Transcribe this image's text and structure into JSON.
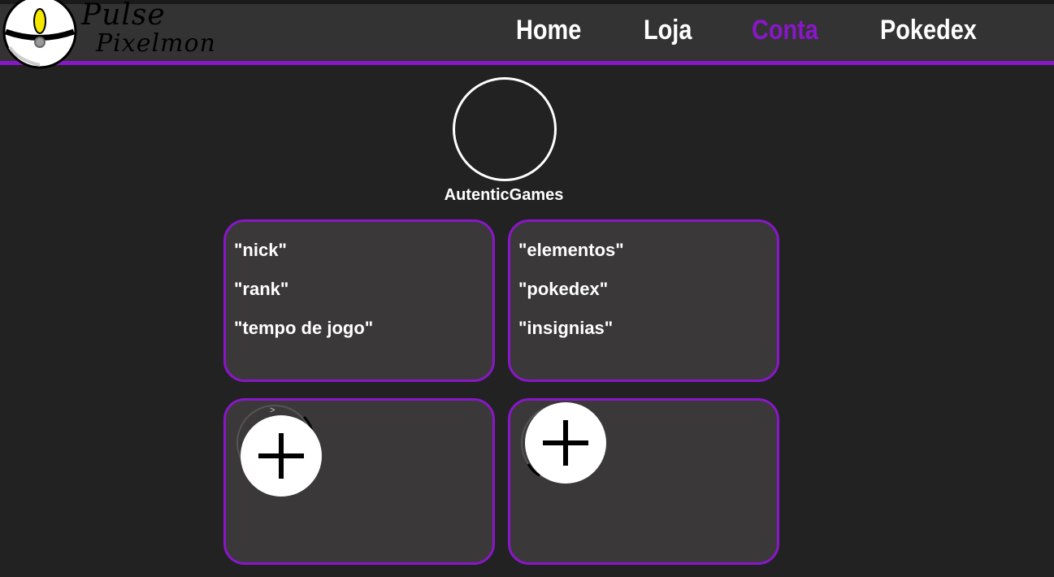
{
  "brand": {
    "line1": "Pulse",
    "line2": "Pixelmon",
    "logo_icon": "pokeball-icon"
  },
  "nav": {
    "items": [
      {
        "label": "Home",
        "active": false
      },
      {
        "label": "Loja",
        "active": false
      },
      {
        "label": "Conta",
        "active": true
      },
      {
        "label": "Pokedex",
        "active": false
      }
    ]
  },
  "profile": {
    "avatar_icon": "avatar-circle",
    "username": "AutenticGames"
  },
  "cards": {
    "player": {
      "lines": [
        "\"nick\"",
        "\"rank\"",
        "\"tempo de jogo\""
      ]
    },
    "stats": {
      "lines": [
        "\"elementos\"",
        "\"pokedex\"",
        "\"insignias\""
      ]
    },
    "slot_left": {
      "icon": "plus-icon",
      "arrow_glyph": ">"
    },
    "slot_right": {
      "icon": "plus-icon"
    }
  },
  "colors": {
    "accent": "#8a16c9",
    "background": "#222222",
    "header": "#333333",
    "card": "#3a3839",
    "text": "#ffffff"
  }
}
